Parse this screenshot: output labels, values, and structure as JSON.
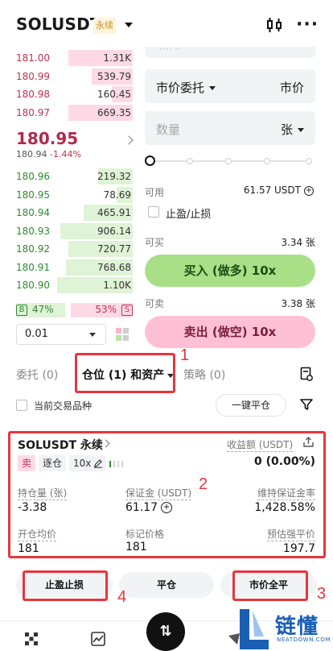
{
  "header": {
    "symbol": "SOLUSDT",
    "badge": "永续",
    "more": "···"
  },
  "order_book": {
    "asks": [
      {
        "price": "181.00",
        "qty": "1.31K",
        "depth": 0.55
      },
      {
        "price": "180.99",
        "qty": "539.79",
        "depth": 0.35
      },
      {
        "price": "180.98",
        "qty": "160.45",
        "depth": 0.18
      },
      {
        "price": "180.97",
        "qty": "669.35",
        "depth": 0.55
      }
    ],
    "last_price": "180.95",
    "mark_price": "180.94",
    "change": "-1.44%",
    "bids": [
      {
        "price": "180.96",
        "qty": "219.32",
        "depth": 0.3
      },
      {
        "price": "180.95",
        "qty": "78.69",
        "depth": 0.14
      },
      {
        "price": "180.94",
        "qty": "465.91",
        "depth": 0.42
      },
      {
        "price": "180.93",
        "qty": "906.14",
        "depth": 0.62
      },
      {
        "price": "180.92",
        "qty": "720.77",
        "depth": 0.55
      },
      {
        "price": "180.91",
        "qty": "768.68",
        "depth": 0.57
      },
      {
        "price": "180.90",
        "qty": "1.10K",
        "depth": 0.65
      }
    ],
    "buy_label": "B",
    "buy_ratio": "47%",
    "sell_ratio": "53%",
    "sell_label": "S",
    "precision": "0.01"
  },
  "order_form": {
    "order_type": "市价委托",
    "price_mode": "市价",
    "qty_placeholder": "数量",
    "qty_unit": "张",
    "available_label": "可用",
    "available_value": "61.57 USDT",
    "tpsl_label": "止盈/止损",
    "can_buy_label": "可买",
    "can_buy_value": "3.34 张",
    "buy_button": "买入 (做多) 10x",
    "can_sell_label": "可卖",
    "can_sell_value": "3.38 张",
    "sell_button": "卖出 (做空) 10x"
  },
  "tabs": {
    "orders": "委托 (0)",
    "positions": "仓位 (1) 和资产",
    "strategy": "策略 (0)"
  },
  "filter": {
    "current_symbol": "当前交易品种",
    "close_all": "一键平仓"
  },
  "position": {
    "symbol": "SOLUSDT 永续",
    "pnl_label": "收益额 (USDT)",
    "side": "卖",
    "margin_mode": "逐仓",
    "leverage": "10x",
    "pnl_value": "0 (0.00%)",
    "size_label": "持仓量 (张)",
    "size_value": "-3.38",
    "margin_label": "保证金 (USDT)",
    "margin_value": "61.17",
    "mmr_label": "维持保证金率",
    "mmr_value": "1,428.58%",
    "entry_label": "开仓均价",
    "entry_value": "181",
    "mark_label": "标记价格",
    "mark_value": "181",
    "liq_label": "预估强平价",
    "liq_value": "197.7"
  },
  "actions": {
    "tpsl": "止盈止损",
    "close": "平仓",
    "market_close_all": "市价全平"
  },
  "annotations": [
    "1",
    "2",
    "3",
    "4"
  ],
  "watermark": {
    "text": "链懂",
    "sub": "NEATDOWN.COM"
  },
  "colors": {
    "ask": "#c2304e",
    "bid": "#2e8a2e",
    "buy_button": "#a9df86",
    "sell_button": "#ffc0d6",
    "highlight": "#e8353d"
  }
}
